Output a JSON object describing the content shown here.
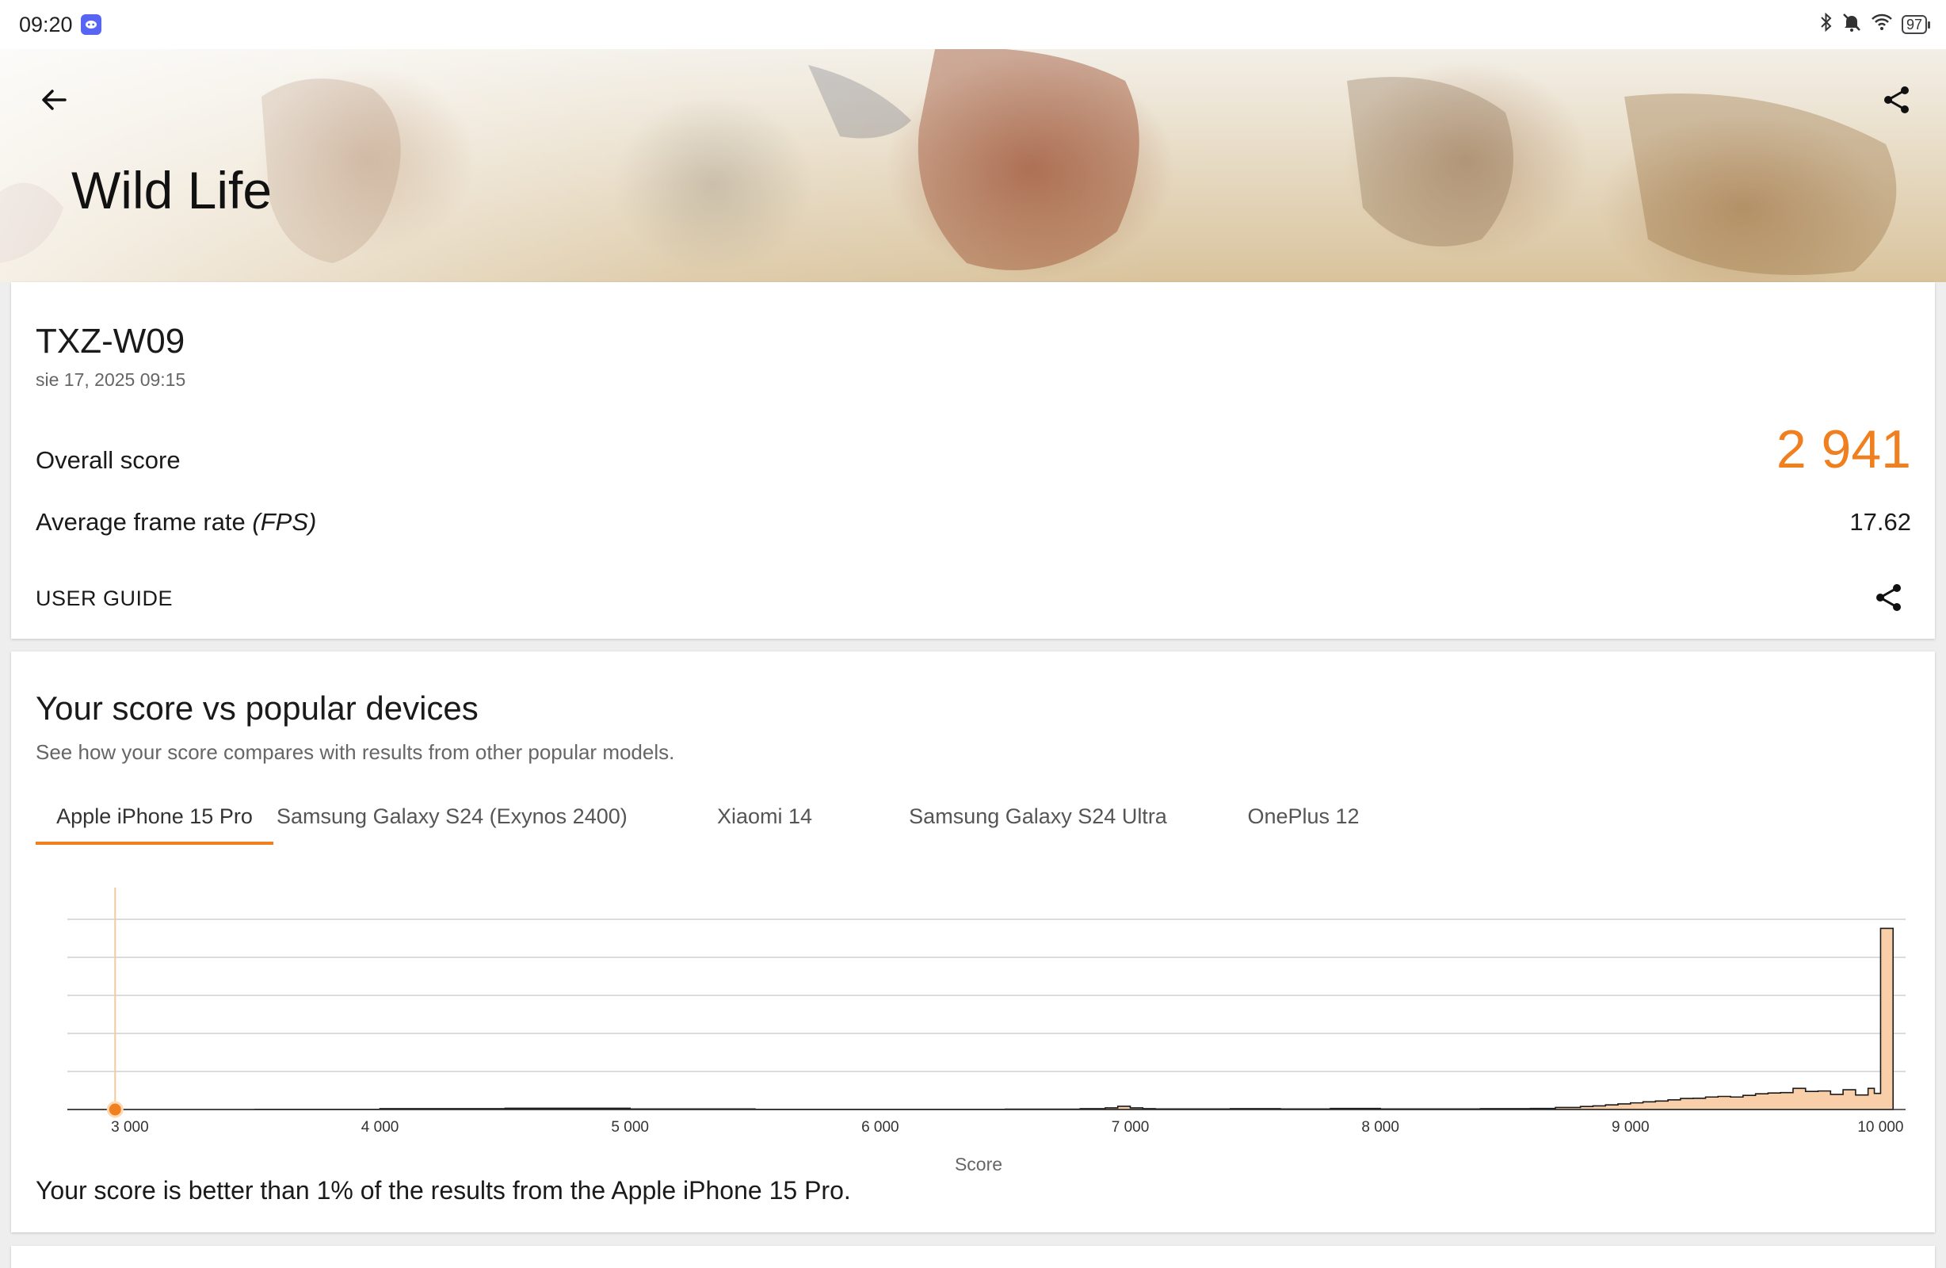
{
  "status_bar": {
    "time": "09:20",
    "battery": "97",
    "icons": [
      "discord-icon",
      "bluetooth-icon",
      "mute-icon",
      "wifi-icon",
      "battery-icon"
    ]
  },
  "header": {
    "title": "Wild Life",
    "back_icon": "arrow-left-icon",
    "share_icon": "share-icon"
  },
  "result": {
    "device": "TXZ-W09",
    "date": "sie 17, 2025 09:15",
    "overall_label": "Overall score",
    "overall_value": "2 941",
    "fps_label": "Average frame rate ",
    "fps_unit": "(FPS)",
    "fps_value": "17.62",
    "user_guide": "USER GUIDE"
  },
  "compare": {
    "title": "Your score vs popular devices",
    "subtitle": "See how your score compares with results from other popular models.",
    "tabs": [
      {
        "label": "Apple iPhone 15 Pro",
        "active": true
      },
      {
        "label": "Samsung Galaxy S24 (Exynos 2400)",
        "active": false
      },
      {
        "label": "Xiaomi 14",
        "active": false
      },
      {
        "label": "Samsung Galaxy S24 Ultra",
        "active": false
      },
      {
        "label": "OnePlus 12",
        "active": false
      }
    ],
    "footer": "Your score is better than 1% of the results from the Apple iPhone 15 Pro."
  },
  "colors": {
    "accent": "#f07f1f",
    "histogram_fill": "#f9cfaa",
    "histogram_stroke": "#1a1a1a",
    "marker": "#f07f1f"
  },
  "chart_data": {
    "type": "area",
    "xlabel": "Score",
    "ylabel": "",
    "xlim": [
      2750,
      10100
    ],
    "xticks": [
      3000,
      4000,
      5000,
      6000,
      7000,
      8000,
      9000,
      10000
    ],
    "xtick_labels": [
      "3 000",
      "4 000",
      "5 000",
      "6 000",
      "7 000",
      "8 000",
      "9 000",
      "10 000"
    ],
    "gridlines": 5,
    "grid": true,
    "user_score": 2941,
    "series": [
      {
        "x": [
          2750,
          3000,
          3500,
          4000,
          4500,
          5000,
          5500,
          6000,
          6500,
          6800,
          6900,
          6950,
          7000,
          7050,
          7100,
          7200,
          7400,
          7600,
          7800,
          8000,
          8200,
          8400,
          8600,
          8700,
          8800,
          8850,
          8900,
          8950,
          9000,
          9050,
          9100,
          9150,
          9200,
          9250,
          9300,
          9350,
          9400,
          9450,
          9500,
          9550,
          9600,
          9650,
          9700,
          9750,
          9800,
          9850,
          9900,
          9950,
          9975,
          10000,
          10025,
          10050
        ],
        "y": [
          0,
          0,
          0.1,
          0.4,
          0.6,
          0.3,
          0.1,
          0.1,
          0.2,
          0.4,
          0.8,
          1.6,
          0.8,
          0.4,
          0.3,
          0.3,
          0.4,
          0.3,
          0.5,
          0.3,
          0.3,
          0.4,
          0.5,
          1.0,
          1.5,
          1.8,
          2.3,
          2.8,
          3.3,
          3.8,
          4.2,
          4.8,
          5.5,
          5.6,
          6.2,
          6.5,
          6.2,
          7.0,
          7.8,
          8.2,
          8.4,
          10.5,
          9.0,
          9.2,
          7.5,
          9.8,
          7.2,
          10.5,
          8.0,
          90,
          90,
          0
        ]
      }
    ]
  }
}
